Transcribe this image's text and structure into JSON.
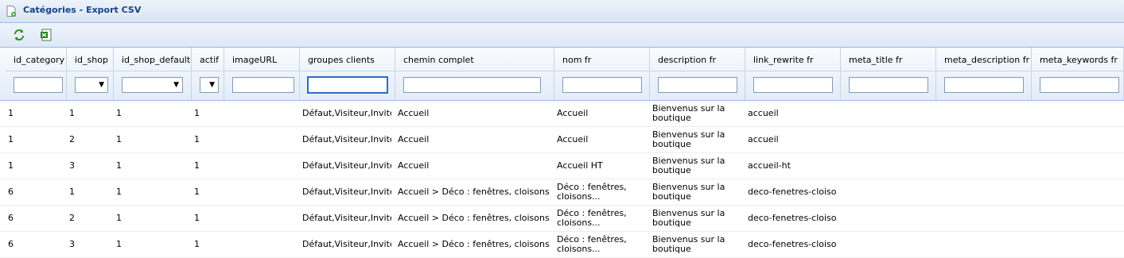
{
  "window": {
    "title": "Catégories - Export CSV",
    "icon": "document-export-icon"
  },
  "toolbar": {
    "buttons": [
      {
        "icon": "refresh-icon"
      },
      {
        "icon": "excel-export-icon"
      }
    ]
  },
  "columns": [
    {
      "label": "id_category",
      "filter": "text"
    },
    {
      "label": "id_shop",
      "filter": "select"
    },
    {
      "label": "id_shop_default",
      "filter": "select"
    },
    {
      "label": "actif",
      "filter": "select"
    },
    {
      "label": "imageURL",
      "filter": "text"
    },
    {
      "label": "groupes clients",
      "filter": "text"
    },
    {
      "label": "chemin complet",
      "filter": "text"
    },
    {
      "label": "nom fr",
      "filter": "text"
    },
    {
      "label": "description fr",
      "filter": "text"
    },
    {
      "label": "link_rewrite fr",
      "filter": "text"
    },
    {
      "label": "meta_title fr",
      "filter": "text"
    },
    {
      "label": "meta_description fr",
      "filter": "text"
    },
    {
      "label": "meta_keywords fr",
      "filter": "text"
    }
  ],
  "rows": [
    [
      "1",
      "1",
      "1",
      "1",
      "",
      "Défaut,Visiteur,Invité",
      "Accueil",
      "Accueil",
      "Bienvenus sur la boutique",
      "accueil",
      "",
      "",
      ""
    ],
    [
      "1",
      "2",
      "1",
      "1",
      "",
      "Défaut,Visiteur,Invité",
      "Accueil",
      "Accueil",
      "Bienvenus sur la boutique",
      "accueil",
      "",
      "",
      ""
    ],
    [
      "1",
      "3",
      "1",
      "1",
      "",
      "Défaut,Visiteur,Invité",
      "Accueil",
      "Accueil HT",
      "Bienvenus sur la boutique",
      "accueil-ht",
      "",
      "",
      ""
    ],
    [
      "6",
      "1",
      "1",
      "1",
      "",
      "Défaut,Visiteur,Invité",
      "Accueil > Déco : fenêtres, cloisons...",
      "Déco : fenêtres, cloisons...",
      "Bienvenus sur la boutique",
      "deco-fenetres-cloisons",
      "",
      "",
      ""
    ],
    [
      "6",
      "2",
      "1",
      "1",
      "",
      "Défaut,Visiteur,Invité",
      "Accueil > Déco : fenêtres, cloisons...",
      "Déco : fenêtres, cloisons...",
      "Bienvenus sur la boutique",
      "deco-fenetres-cloisons",
      "",
      "",
      ""
    ],
    [
      "6",
      "3",
      "1",
      "1",
      "",
      "Défaut,Visiteur,Invité",
      "Accueil > Déco : fenêtres, cloisons...",
      "Déco : fenêtres, cloisons...",
      "Bienvenus sur la boutique",
      "deco-fenetres-cloisons",
      "",
      "",
      ""
    ]
  ]
}
